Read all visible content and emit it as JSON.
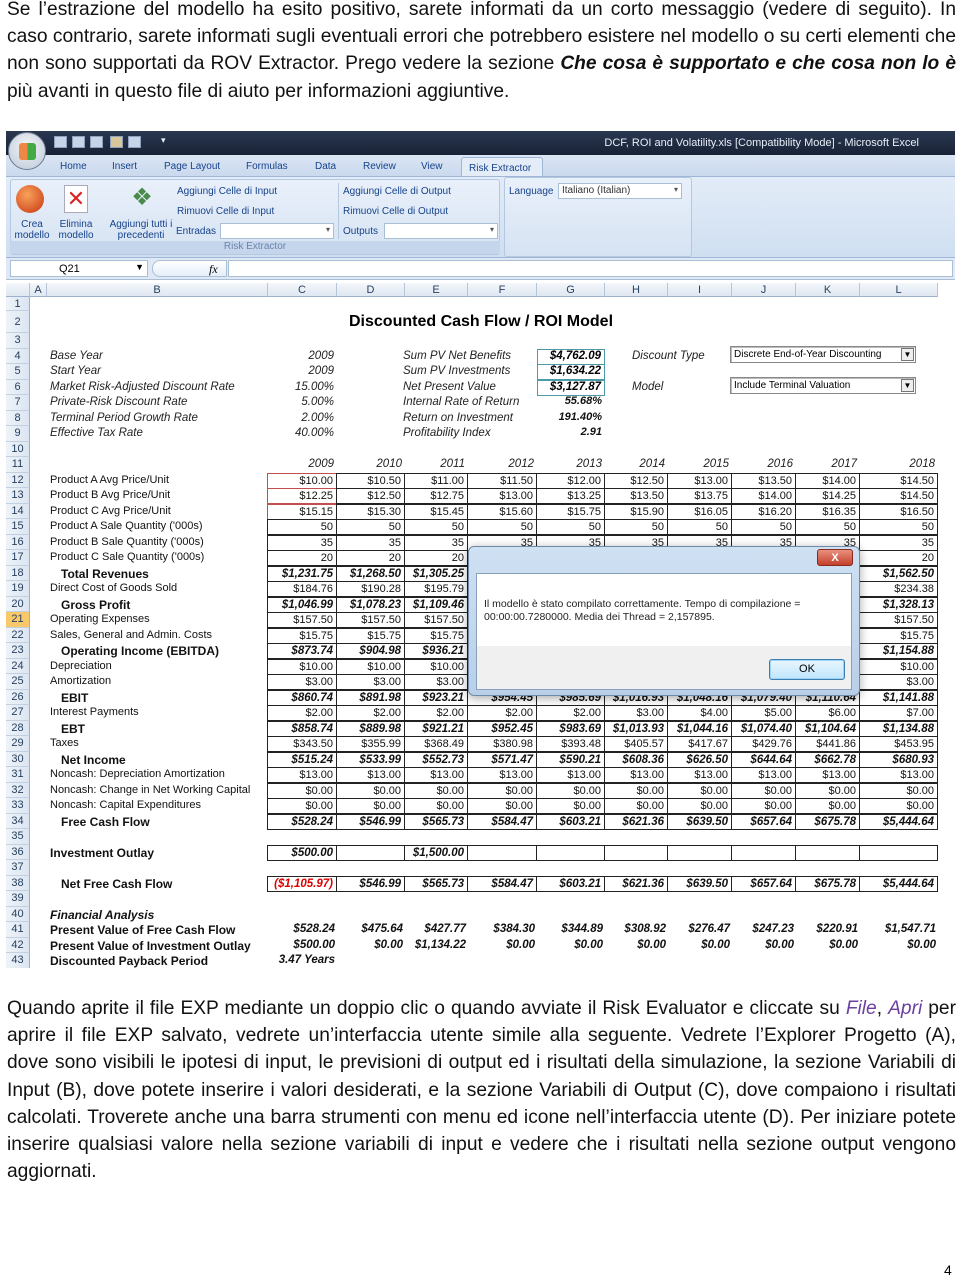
{
  "intro": {
    "before": "Se l’estrazione del modello ha esito positivo, sarete informati da un corto messaggio (vedere di seguito). In caso contrario, sarete informati sugli eventuali errori che potrebbero esistere nel modello o su certi elementi che non sono supportati da ROV Extractor. Prego vedere la sezione ",
    "emph": "Che cosa è supportato e che cosa non lo è",
    "after": " più avanti in questo file di aiuto per informazioni aggiuntive."
  },
  "excel": {
    "window_title": "DCF, ROI and Volatility.xls  [Compatibility Mode] - Microsoft Excel",
    "tabs": [
      "Home",
      "Insert",
      "Page Layout",
      "Formulas",
      "Data",
      "Review",
      "View"
    ],
    "active_tab": "Risk Extractor",
    "ribbon": {
      "crea": "Crea modello",
      "elimina": "Elimina modello",
      "aggiungi_tutti": "Aggiungi tutti i precedenti",
      "add_input": "Aggiungi Celle di Input",
      "remove_input": "Rimuovi Celle di Input",
      "entradas_label": "Entradas",
      "entradas_value": "",
      "add_output": "Aggiungi Celle di Output",
      "remove_output": "Rimuovi Celle di Output",
      "outputs_label": "Outputs",
      "outputs_value": "",
      "language_label": "Language",
      "language_value": "Italiano (Italian)",
      "group_label": "Risk Extractor"
    },
    "name_box": "Q21",
    "fx": "fx",
    "columns": [
      "A",
      "B",
      "C",
      "D",
      "E",
      "F",
      "G",
      "H",
      "I",
      "J",
      "K",
      "L"
    ],
    "selected_row": 21,
    "sheet": {
      "title": "Discounted Cash Flow / ROI Model",
      "assumptions": [
        {
          "label": "Base Year",
          "value": "2009"
        },
        {
          "label": "Start Year",
          "value": "2009"
        },
        {
          "label": "Market Risk-Adjusted Discount Rate",
          "value": "15.00%"
        },
        {
          "label": "Private-Risk Discount Rate",
          "value": "5.00%"
        },
        {
          "label": "Terminal Period Growth Rate",
          "value": "2.00%"
        },
        {
          "label": "Effective Tax Rate",
          "value": "40.00%"
        }
      ],
      "results": [
        {
          "label": "Sum PV Net Benefits",
          "value": "$4,762.09"
        },
        {
          "label": "Sum PV Investments",
          "value": "$1,634.22"
        },
        {
          "label": "Net Present Value",
          "value": "$3,127.87"
        },
        {
          "label": "Internal Rate of Return",
          "value": "55.68%"
        },
        {
          "label": "Return on Investment",
          "value": "191.40%"
        },
        {
          "label": "Profitability Index",
          "value": "2.91"
        }
      ],
      "discount_type_label": "Discount Type",
      "discount_type_value": "Discrete End-of-Year Discounting",
      "model_label": "Model",
      "model_value": "Include Terminal Valuation",
      "years": [
        "2009",
        "2010",
        "2011",
        "2012",
        "2013",
        "2014",
        "2015",
        "2016",
        "2017",
        "2018"
      ],
      "rows": [
        {
          "n": 12,
          "label": "Product A Avg Price/Unit",
          "style": "input",
          "values": [
            "$10.00",
            "$10.50",
            "$11.00",
            "$11.50",
            "$12.00",
            "$12.50",
            "$13.00",
            "$13.50",
            "$14.00",
            "$14.50"
          ]
        },
        {
          "n": 13,
          "label": "Product B Avg Price/Unit",
          "style": "input",
          "values": [
            "$12.25",
            "$12.50",
            "$12.75",
            "$13.00",
            "$13.25",
            "$13.50",
            "$13.75",
            "$14.00",
            "$14.25",
            "$14.50"
          ]
        },
        {
          "n": 14,
          "label": "Product C Avg Price/Unit",
          "style": "input",
          "values": [
            "$15.15",
            "$15.30",
            "$15.45",
            "$15.60",
            "$15.75",
            "$15.90",
            "$16.05",
            "$16.20",
            "$16.35",
            "$16.50"
          ]
        },
        {
          "n": 15,
          "label": "Product A Sale Quantity ('000s)",
          "style": "plain",
          "values": [
            "50",
            "50",
            "50",
            "50",
            "50",
            "50",
            "50",
            "50",
            "50",
            "50"
          ]
        },
        {
          "n": 16,
          "label": "Product B Sale Quantity ('000s)",
          "style": "plain",
          "values": [
            "35",
            "35",
            "35",
            "35",
            "35",
            "35",
            "35",
            "35",
            "35",
            "35"
          ]
        },
        {
          "n": 17,
          "label": "Product C Sale Quantity ('000s)",
          "style": "plain",
          "values": [
            "20",
            "20",
            "20",
            "",
            "",
            "",
            "",
            "",
            "",
            "20"
          ]
        },
        {
          "n": 18,
          "label": "Total Revenues",
          "style": "total",
          "values": [
            "$1,231.75",
            "$1,268.50",
            "$1,305.25",
            "",
            "",
            "",
            "",
            "",
            "",
            "$1,562.50"
          ]
        },
        {
          "n": 19,
          "label": "Direct Cost of Goods Sold",
          "style": "plain",
          "values": [
            "$184.76",
            "$190.28",
            "$195.79",
            "",
            "",
            "",
            "",
            "",
            "",
            "$234.38"
          ]
        },
        {
          "n": 20,
          "label": "Gross Profit",
          "style": "total",
          "values": [
            "$1,046.99",
            "$1,078.23",
            "$1,109.46",
            "",
            "",
            "",
            "",
            "",
            "",
            "$1,328.13"
          ]
        },
        {
          "n": 21,
          "label": "Operating Expenses",
          "style": "plain",
          "values": [
            "$157.50",
            "$157.50",
            "$157.50",
            "",
            "",
            "",
            "",
            "",
            "",
            "$157.50"
          ]
        },
        {
          "n": 22,
          "label": "Sales, General and Admin. Costs",
          "style": "plain",
          "values": [
            "$15.75",
            "$15.75",
            "$15.75",
            "",
            "",
            "",
            "",
            "",
            "",
            "$15.75"
          ]
        },
        {
          "n": 23,
          "label": "Operating Income (EBITDA)",
          "style": "total",
          "values": [
            "$873.74",
            "$904.98",
            "$936.21",
            "",
            "",
            "",
            "",
            "",
            "",
            "$1,154.88"
          ]
        },
        {
          "n": 24,
          "label": "Depreciation",
          "style": "plain",
          "values": [
            "$10.00",
            "$10.00",
            "$10.00",
            "",
            "",
            "",
            "",
            "",
            "",
            "$10.00"
          ]
        },
        {
          "n": 25,
          "label": "Amortization",
          "style": "plain",
          "values": [
            "$3.00",
            "$3.00",
            "$3.00",
            "",
            "",
            "",
            "",
            "",
            "",
            "$3.00"
          ]
        },
        {
          "n": 26,
          "label": "EBIT",
          "style": "total",
          "values": [
            "$860.74",
            "$891.98",
            "$923.21",
            "$954.45",
            "$985.69",
            "$1,016.93",
            "$1,048.16",
            "$1,079.40",
            "$1,110.64",
            "$1,141.88"
          ]
        },
        {
          "n": 27,
          "label": "Interest Payments",
          "style": "plain",
          "values": [
            "$2.00",
            "$2.00",
            "$2.00",
            "$2.00",
            "$2.00",
            "$3.00",
            "$4.00",
            "$5.00",
            "$6.00",
            "$7.00"
          ]
        },
        {
          "n": 28,
          "label": "EBT",
          "style": "total",
          "values": [
            "$858.74",
            "$889.98",
            "$921.21",
            "$952.45",
            "$983.69",
            "$1,013.93",
            "$1,044.16",
            "$1,074.40",
            "$1,104.64",
            "$1,134.88"
          ]
        },
        {
          "n": 29,
          "label": "Taxes",
          "style": "plain",
          "values": [
            "$343.50",
            "$355.99",
            "$368.49",
            "$380.98",
            "$393.48",
            "$405.57",
            "$417.67",
            "$429.76",
            "$441.86",
            "$453.95"
          ]
        },
        {
          "n": 30,
          "label": "Net Income",
          "style": "total",
          "values": [
            "$515.24",
            "$533.99",
            "$552.73",
            "$571.47",
            "$590.21",
            "$608.36",
            "$626.50",
            "$644.64",
            "$662.78",
            "$680.93"
          ]
        },
        {
          "n": 31,
          "label": "Noncash: Depreciation Amortization",
          "style": "plain",
          "values": [
            "$13.00",
            "$13.00",
            "$13.00",
            "$13.00",
            "$13.00",
            "$13.00",
            "$13.00",
            "$13.00",
            "$13.00",
            "$13.00"
          ]
        },
        {
          "n": 32,
          "label": "Noncash: Change in Net Working Capital",
          "style": "plain",
          "values": [
            "$0.00",
            "$0.00",
            "$0.00",
            "$0.00",
            "$0.00",
            "$0.00",
            "$0.00",
            "$0.00",
            "$0.00",
            "$0.00"
          ]
        },
        {
          "n": 33,
          "label": "Noncash: Capital Expenditures",
          "style": "plain",
          "values": [
            "$0.00",
            "$0.00",
            "$0.00",
            "$0.00",
            "$0.00",
            "$0.00",
            "$0.00",
            "$0.00",
            "$0.00",
            "$0.00"
          ]
        },
        {
          "n": 34,
          "label": "Free Cash Flow",
          "style": "total",
          "values": [
            "$528.24",
            "$546.99",
            "$565.73",
            "$584.47",
            "$603.21",
            "$621.36",
            "$639.50",
            "$657.64",
            "$675.78",
            "$5,444.64"
          ]
        },
        {
          "n": 36,
          "label": "Investment Outlay",
          "style": "boxbold",
          "values": [
            "$500.00",
            "",
            "$1,500.00",
            "",
            "",
            "",
            "",
            "",
            "",
            ""
          ]
        },
        {
          "n": 38,
          "label": "Net Free Cash Flow",
          "style": "total",
          "values": [
            "($1,105.97)",
            "$546.99",
            "$565.73",
            "$584.47",
            "$603.21",
            "$621.36",
            "$639.50",
            "$657.64",
            "$675.78",
            "$5,444.64"
          ]
        },
        {
          "n": 40,
          "label": "Financial Analysis",
          "style": "heading",
          "values": []
        },
        {
          "n": 41,
          "label": "Present Value of Free Cash Flow",
          "style": "analysis",
          "values": [
            "$528.24",
            "$475.64",
            "$427.77",
            "$384.30",
            "$344.89",
            "$308.92",
            "$276.47",
            "$247.23",
            "$220.91",
            "$1,547.71"
          ]
        },
        {
          "n": 42,
          "label": "Present Value of Investment Outlay",
          "style": "analysis",
          "values": [
            "$500.00",
            "$0.00",
            "$1,134.22",
            "$0.00",
            "$0.00",
            "$0.00",
            "$0.00",
            "$0.00",
            "$0.00",
            "$0.00"
          ]
        },
        {
          "n": 43,
          "label": "Discounted Payback Period",
          "style": "analysis",
          "values": [
            "3.47 Years"
          ]
        }
      ],
      "negative_color": "#dd0000"
    },
    "dialog": {
      "message": "Il modello è stato compilato correttamente. Tempo di compilazione = 00:00:00.7280000. Media dei Thread = 2,157895.",
      "ok": "OK",
      "close": "X"
    }
  },
  "body": {
    "before": "Quando aprite il file EXP mediante un doppio clic o quando avviate il Risk Evaluator e cliccate su ",
    "file": "File",
    "comma": ", ",
    "apri": "Apri",
    "after": " per aprire il file EXP salvato, vedrete un’interfaccia utente simile alla seguente. Vedrete l’Explorer Progetto (A), dove sono visibili le ipotesi di input, le previsioni di output ed i risultati della simulazione, la sezione Variabili di Input (B), dove potete inserire i valori desiderati, e la sezione Variabili di Output (C), dove compaiono i risultati calcolati. Troverete anche una barra strumenti con menu ed icone nell’interfaccia utente (D). Per iniziare potete inserire qualsiasi valore nella sezione variabili di input e vedere che i risultati nella sezione output vengono aggiornati."
  },
  "page_number": "4"
}
